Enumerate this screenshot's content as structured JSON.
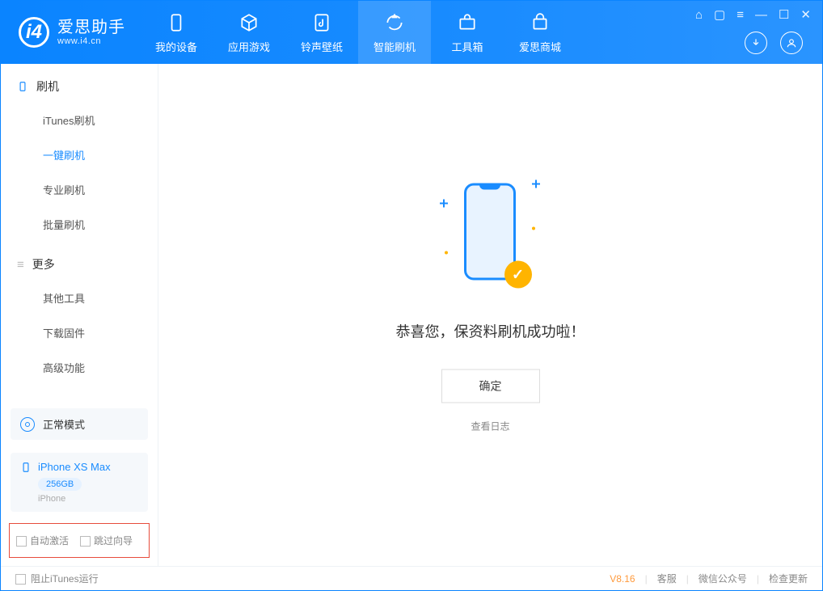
{
  "logo": {
    "title": "爱思助手",
    "subtitle": "www.i4.cn"
  },
  "tabs": [
    {
      "label": "我的设备",
      "icon": "device-icon"
    },
    {
      "label": "应用游戏",
      "icon": "cube-icon"
    },
    {
      "label": "铃声壁纸",
      "icon": "music-icon"
    },
    {
      "label": "智能刷机",
      "icon": "refresh-icon",
      "selected": true
    },
    {
      "label": "工具箱",
      "icon": "toolbox-icon"
    },
    {
      "label": "爱思商城",
      "icon": "cart-icon"
    }
  ],
  "sidebar": {
    "group1_title": "刷机",
    "group1_items": [
      "iTunes刷机",
      "一键刷机",
      "专业刷机",
      "批量刷机"
    ],
    "group1_active_index": 1,
    "group2_title": "更多",
    "group2_items": [
      "其他工具",
      "下载固件",
      "高级功能"
    ]
  },
  "mode": {
    "label": "正常模式"
  },
  "device": {
    "name": "iPhone XS Max",
    "storage": "256GB",
    "type": "iPhone"
  },
  "options": {
    "auto_activate": "自动激活",
    "skip_guide": "跳过向导"
  },
  "main": {
    "success_text": "恭喜您，保资料刷机成功啦！",
    "confirm": "确定",
    "view_log": "查看日志"
  },
  "footer": {
    "block_itunes": "阻止iTunes运行",
    "version": "V8.16",
    "links": [
      "客服",
      "微信公众号",
      "检查更新"
    ]
  }
}
